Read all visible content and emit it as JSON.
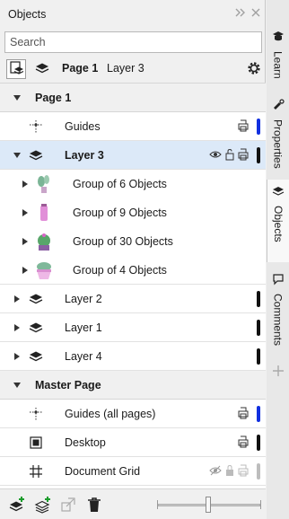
{
  "window": {
    "title": "Objects"
  },
  "search": {
    "placeholder": "Search",
    "value": ""
  },
  "toolbar": {
    "page_label": "Page 1",
    "layer_label": "Layer 3"
  },
  "tree": {
    "page1": "Page 1",
    "guides": "Guides",
    "layer3": "Layer 3",
    "group6": "Group of 6 Objects",
    "group9": "Group of 9 Objects",
    "group30": "Group of 30 Objects",
    "group4": "Group of 4 Objects",
    "layer2": "Layer 2",
    "layer1": "Layer 1",
    "layer4": "Layer 4",
    "master": "Master Page",
    "guides_all": "Guides (all pages)",
    "desktop": "Desktop",
    "document_grid": "Document Grid"
  },
  "colors": {
    "guides_blue": "#1230e0",
    "layer_black": "#111111",
    "grid_gray": "#bdbdbd",
    "selection": "#dce9f8"
  },
  "right_tabs": {
    "learn": "Learn",
    "properties": "Properties",
    "objects": "Objects",
    "comments": "Comments"
  },
  "icons": [
    "hide-panel-icon",
    "close-panel-icon",
    "page-layer-view-icon",
    "layers-icon",
    "settings-gear-icon",
    "guides-icon",
    "eye-icon",
    "unlock-icon",
    "printer-icon",
    "desktop-icon",
    "grid-icon",
    "new-layer-icon",
    "new-master-layer-icon",
    "move-to-layer-icon",
    "delete-icon",
    "add-tab-icon"
  ]
}
